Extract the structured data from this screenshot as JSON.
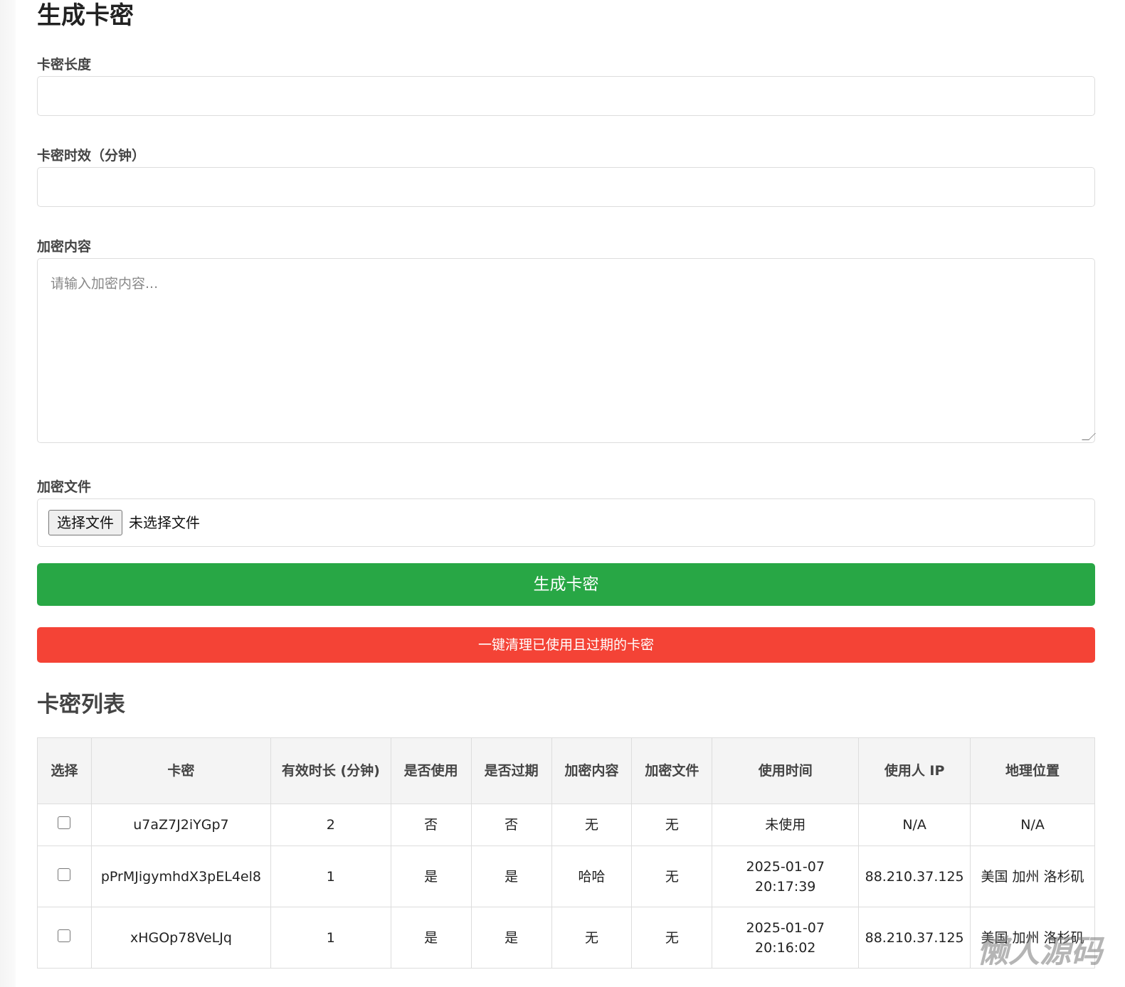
{
  "title": "生成卡密",
  "fields": {
    "length_label": "卡密长度",
    "length_value": "",
    "expiry_label": "卡密时效（分钟）",
    "expiry_value": "",
    "content_label": "加密内容",
    "content_placeholder": "请输入加密内容...",
    "file_label": "加密文件",
    "file_button": "选择文件",
    "file_status": "未选择文件"
  },
  "buttons": {
    "generate": "生成卡密",
    "generate_color": "#28a745",
    "clean": "一键清理已使用且过期的卡密",
    "clean_color": "#f44336"
  },
  "list": {
    "title": "卡密列表",
    "headers": [
      "选择",
      "卡密",
      "有效时长 (分钟)",
      "是否使用",
      "是否过期",
      "加密内容",
      "加密文件",
      "使用时间",
      "使用人 IP",
      "地理位置"
    ],
    "rows": [
      [
        "",
        "u7aZ7J2iYGp7",
        "2",
        "否",
        "否",
        "无",
        "无",
        "未使用",
        "N/A",
        "N/A"
      ],
      [
        "",
        "pPrMJigymhdX3pEL4el8",
        "1",
        "是",
        "是",
        "哈哈",
        "无",
        "2025-01-07 20:17:39",
        "88.210.37.125",
        "美国 加州 洛杉矶"
      ],
      [
        "",
        "xHGOp78VeLJq",
        "1",
        "是",
        "是",
        "无",
        "无",
        "2025-01-07 20:16:02",
        "88.210.37.125",
        "美国 加州 洛杉矶"
      ]
    ]
  },
  "watermark": "懒人源码"
}
